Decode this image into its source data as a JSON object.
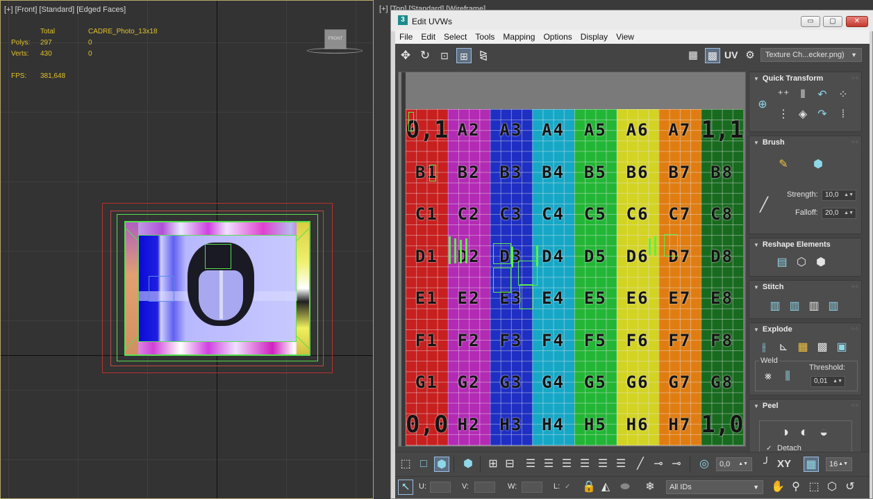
{
  "front_viewport": {
    "label": "[+] [Front] [Standard] [Edged Faces]",
    "stats": {
      "col_total": "Total",
      "col_object": "CADRE_Photo_13x18",
      "polys_label": "Polys:",
      "polys_total": "297",
      "polys_object": "0",
      "verts_label": "Verts:",
      "verts_total": "430",
      "verts_object": "0",
      "fps_label": "FPS:",
      "fps_value": "381,648"
    },
    "viewcube_face": "FRONT",
    "stats_color": "#e2c22a"
  },
  "back_viewport": {
    "label": "[+] [Top] [Standard] [Wireframe]"
  },
  "uvw_window": {
    "app_icon": "3",
    "title": "Edit UVWs",
    "controls": {
      "minimize": "▭",
      "maximize": "▢",
      "close": "✕"
    },
    "menu": [
      "File",
      "Edit",
      "Select",
      "Tools",
      "Mapping",
      "Options",
      "Display",
      "View"
    ],
    "top_toolbar": {
      "icons": [
        "move-icon",
        "rotate-icon",
        "scale-icon",
        "freeform-icon",
        "mirror-icon"
      ],
      "uv_label": "UV",
      "texture_dropdown": "Texture Ch...ecker.png)"
    },
    "checker": {
      "rows": [
        [
          "0,1",
          "A2",
          "A3",
          "A4",
          "A5",
          "A6",
          "A7",
          "1,1"
        ],
        [
          "B1",
          "B2",
          "B3",
          "B4",
          "B5",
          "B6",
          "B7",
          "B8"
        ],
        [
          "C1",
          "C2",
          "C3",
          "C4",
          "C5",
          "C6",
          "C7",
          "C8"
        ],
        [
          "D1",
          "D2",
          "D3",
          "D4",
          "D5",
          "D6",
          "D7",
          "D8"
        ],
        [
          "E1",
          "E2",
          "E3",
          "E4",
          "E5",
          "E6",
          "E7",
          "E8"
        ],
        [
          "F1",
          "F2",
          "F3",
          "F4",
          "F5",
          "F6",
          "F7",
          "F8"
        ],
        [
          "G1",
          "G2",
          "G3",
          "G4",
          "G5",
          "G6",
          "G7",
          "G8"
        ],
        [
          "0,0",
          "H2",
          "H3",
          "H4",
          "H5",
          "H6",
          "H7",
          "1,0"
        ]
      ],
      "column_colors": [
        "#c81f1f",
        "#b32ab4",
        "#1f2fc3",
        "#16a7c7",
        "#23b636",
        "#d3d324",
        "#e07d12",
        "#186a1f"
      ],
      "uv_shell_color": "#5cef47"
    },
    "rollouts": {
      "quick_transform": {
        "title": "Quick Transform"
      },
      "brush": {
        "title": "Brush",
        "strength_label": "Strength:",
        "strength_value": "10,0",
        "falloff_label": "Falloff:",
        "falloff_value": "20,0"
      },
      "reshape": {
        "title": "Reshape Elements"
      },
      "stitch": {
        "title": "Stitch"
      },
      "explode": {
        "title": "Explode",
        "weld_label": "Weld",
        "threshold_label": "Threshold:",
        "threshold_value": "0,01"
      },
      "peel": {
        "title": "Peel",
        "detach_label": "Detach",
        "detach_checked": "✓"
      }
    },
    "bottom_toolbar": {
      "soft_value": "0,0",
      "xy_label": "XY",
      "grid_value": "16",
      "u_label": "U:",
      "v_label": "V:",
      "w_label": "W:",
      "l_label": "L:",
      "l_checked": "✓",
      "id_dropdown": "All IDs"
    }
  }
}
